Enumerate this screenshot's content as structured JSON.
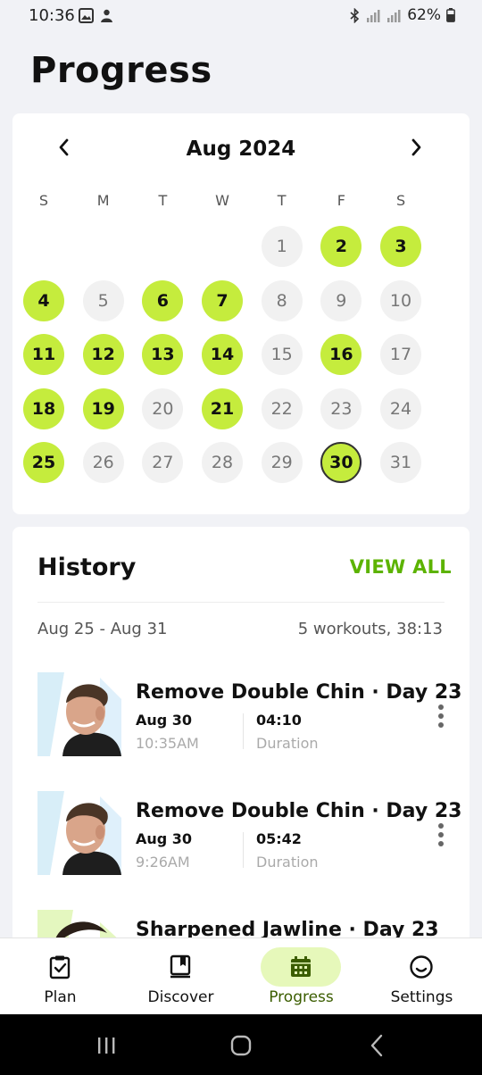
{
  "status_bar": {
    "time": "10:36",
    "battery": "62%",
    "icons": [
      "gallery-icon",
      "notification-icon",
      "bluetooth-icon",
      "signal-icon",
      "signal-icon",
      "battery-icon"
    ]
  },
  "page": {
    "title": "Progress"
  },
  "calendar": {
    "month_label": "Aug 2024",
    "weekdays": [
      "S",
      "M",
      "T",
      "W",
      "T",
      "F",
      "S"
    ],
    "first_weekday": 4,
    "highlight_color": "#c5ec3d",
    "days": [
      {
        "label": "1",
        "done": false
      },
      {
        "label": "2",
        "done": true
      },
      {
        "label": "3",
        "done": true
      },
      {
        "label": "4",
        "done": true
      },
      {
        "label": "5",
        "done": false
      },
      {
        "label": "6",
        "done": true
      },
      {
        "label": "7",
        "done": true
      },
      {
        "label": "8",
        "done": false
      },
      {
        "label": "9",
        "done": false
      },
      {
        "label": "10",
        "done": false
      },
      {
        "label": "11",
        "done": true
      },
      {
        "label": "12",
        "done": true
      },
      {
        "label": "13",
        "done": true
      },
      {
        "label": "14",
        "done": true
      },
      {
        "label": "15",
        "done": false
      },
      {
        "label": "16",
        "done": true
      },
      {
        "label": "17",
        "done": false
      },
      {
        "label": "18",
        "done": true
      },
      {
        "label": "19",
        "done": true
      },
      {
        "label": "20",
        "done": false
      },
      {
        "label": "21",
        "done": true
      },
      {
        "label": "22",
        "done": false
      },
      {
        "label": "23",
        "done": false
      },
      {
        "label": "24",
        "done": false
      },
      {
        "label": "25",
        "done": true
      },
      {
        "label": "26",
        "done": false
      },
      {
        "label": "27",
        "done": false
      },
      {
        "label": "28",
        "done": false
      },
      {
        "label": "29",
        "done": false
      },
      {
        "label": "30",
        "done": true,
        "today": true
      },
      {
        "label": "31",
        "done": false
      }
    ]
  },
  "history": {
    "title": "History",
    "view_all": "VIEW ALL",
    "week_range": "Aug 25 - Aug 31",
    "week_summary": "5 workouts, 38:13",
    "workouts": [
      {
        "title": "Remove Double Chin · Day 23",
        "date": "Aug 30",
        "time": "10:35AM",
        "duration": "04:10",
        "duration_label": "Duration"
      },
      {
        "title": "Remove Double Chin · Day 23",
        "date": "Aug 30",
        "time": "9:26AM",
        "duration": "05:42",
        "duration_label": "Duration"
      },
      {
        "title": "Sharpened Jawline · Day 23",
        "date": "",
        "time": "",
        "duration": "",
        "duration_label": ""
      }
    ]
  },
  "bottom_nav": {
    "items": [
      {
        "label": "Plan",
        "icon": "clipboard-check-icon",
        "active": false
      },
      {
        "label": "Discover",
        "icon": "book-icon",
        "active": false
      },
      {
        "label": "Progress",
        "icon": "calendar-icon",
        "active": true
      },
      {
        "label": "Settings",
        "icon": "smiley-icon",
        "active": false
      }
    ]
  },
  "system_nav": {
    "buttons": [
      "recents-icon",
      "home-icon",
      "back-icon"
    ]
  }
}
